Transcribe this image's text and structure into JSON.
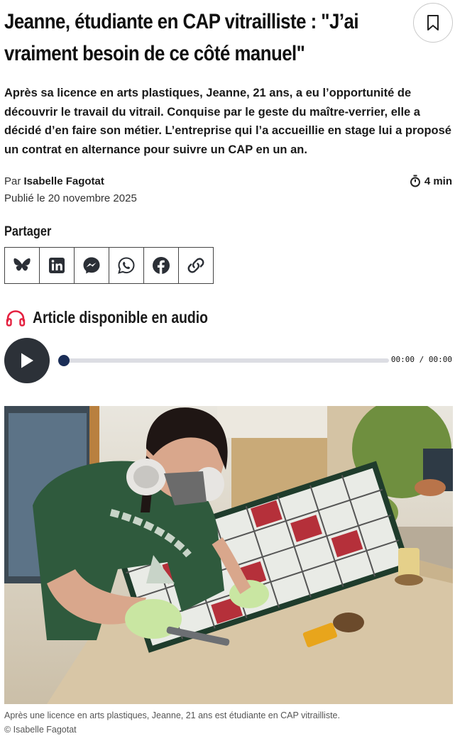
{
  "article": {
    "title": "Jeanne, étudiante en CAP vitrailliste : \"J’ai vraiment besoin de ce côté manuel\"",
    "lead": "Après sa licence en arts plastiques, Jeanne, 21 ans, a eu l’opportunité de découvrir le travail du vitrail. Conquise par le geste du maître-verrier, elle a décidé d’en faire son métier. L’entreprise qui l’a accueillie en stage lui a proposé un contrat en alternance pour suivre un CAP en un an.",
    "byline_prefix": "Par",
    "author": "Isabelle Fagotat",
    "reading_time": "4 min",
    "published": "Publié le 20 novembre 2025"
  },
  "bookmark": {
    "icon": "bookmark-icon"
  },
  "share": {
    "label": "Partager",
    "buttons": [
      {
        "name": "bluesky",
        "icon": "bluesky-icon"
      },
      {
        "name": "linkedin",
        "icon": "linkedin-icon"
      },
      {
        "name": "messenger",
        "icon": "messenger-icon"
      },
      {
        "name": "whatsapp",
        "icon": "whatsapp-icon"
      },
      {
        "name": "facebook",
        "icon": "facebook-icon"
      },
      {
        "name": "copy-link",
        "icon": "link-icon"
      }
    ]
  },
  "audio": {
    "label": "Article disponible en audio",
    "time": "00:00 / 00:00",
    "progress": 0,
    "accent_color": "#e4203f"
  },
  "image": {
    "caption": "Après une licence en arts plastiques, Jeanne, 21 ans est étudiante en CAP vitrailliste.",
    "credit": "© Isabelle Fagotat"
  }
}
